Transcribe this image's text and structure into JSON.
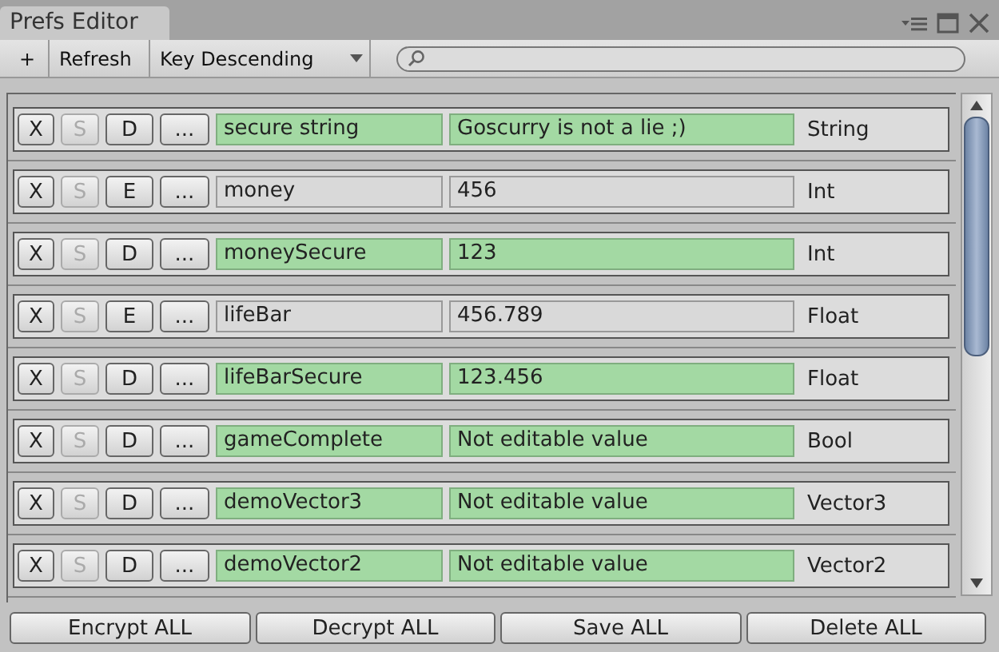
{
  "window": {
    "title": "Prefs Editor"
  },
  "toolbar": {
    "add": "+",
    "refresh": "Refresh",
    "sort": "Key Descending"
  },
  "rows": [
    {
      "buttons": [
        {
          "label": "X",
          "disabled": false
        },
        {
          "label": "S",
          "disabled": true
        },
        {
          "label": "D",
          "disabled": false
        },
        {
          "label": "...",
          "disabled": false
        }
      ],
      "encrypted": true,
      "key": "secure string",
      "value": "Goscurry is not a lie ;)",
      "type": "String"
    },
    {
      "buttons": [
        {
          "label": "X",
          "disabled": false
        },
        {
          "label": "S",
          "disabled": true
        },
        {
          "label": "E",
          "disabled": false
        },
        {
          "label": "...",
          "disabled": false
        }
      ],
      "encrypted": false,
      "key": "money",
      "value": "456",
      "type": "Int"
    },
    {
      "buttons": [
        {
          "label": "X",
          "disabled": false
        },
        {
          "label": "S",
          "disabled": true
        },
        {
          "label": "D",
          "disabled": false
        },
        {
          "label": "...",
          "disabled": false
        }
      ],
      "encrypted": true,
      "key": "moneySecure",
      "value": "123",
      "type": "Int"
    },
    {
      "buttons": [
        {
          "label": "X",
          "disabled": false
        },
        {
          "label": "S",
          "disabled": true
        },
        {
          "label": "E",
          "disabled": false
        },
        {
          "label": "...",
          "disabled": false
        }
      ],
      "encrypted": false,
      "key": "lifeBar",
      "value": "456.789",
      "type": "Float"
    },
    {
      "buttons": [
        {
          "label": "X",
          "disabled": false
        },
        {
          "label": "S",
          "disabled": true
        },
        {
          "label": "D",
          "disabled": false
        },
        {
          "label": "...",
          "disabled": false
        }
      ],
      "encrypted": true,
      "key": "lifeBarSecure",
      "value": "123.456",
      "type": "Float"
    },
    {
      "buttons": [
        {
          "label": "X",
          "disabled": false
        },
        {
          "label": "S",
          "disabled": true
        },
        {
          "label": "D",
          "disabled": false
        },
        {
          "label": "...",
          "disabled": false
        }
      ],
      "encrypted": true,
      "key": "gameComplete",
      "value": "Not editable value",
      "type": "Bool"
    },
    {
      "buttons": [
        {
          "label": "X",
          "disabled": false
        },
        {
          "label": "S",
          "disabled": true
        },
        {
          "label": "D",
          "disabled": false
        },
        {
          "label": "...",
          "disabled": false
        }
      ],
      "encrypted": true,
      "key": "demoVector3",
      "value": "Not editable value",
      "type": "Vector3"
    },
    {
      "buttons": [
        {
          "label": "X",
          "disabled": false
        },
        {
          "label": "S",
          "disabled": true
        },
        {
          "label": "D",
          "disabled": false
        },
        {
          "label": "...",
          "disabled": false
        }
      ],
      "encrypted": true,
      "key": "demoVector2",
      "value": "Not editable value",
      "type": "Vector2"
    }
  ],
  "actions": [
    "Encrypt ALL",
    "Decrypt ALL",
    "Save ALL",
    "Delete ALL"
  ]
}
